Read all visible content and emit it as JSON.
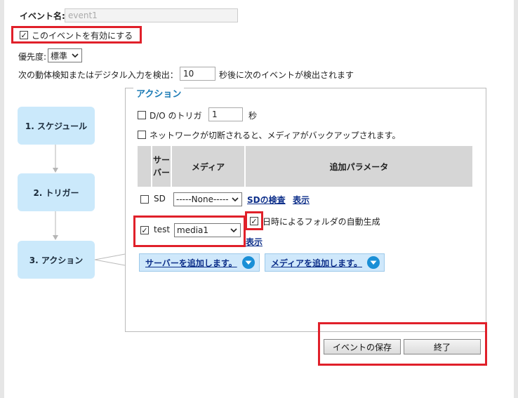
{
  "event_name": {
    "label": "イベント名:",
    "value": "event1"
  },
  "enable_event": {
    "label": "このイベントを有効にする",
    "checked": true,
    "mark": "✓"
  },
  "priority": {
    "label": "優先度:",
    "value": "標準"
  },
  "detection": {
    "prefix": "次の動体検知またはデジタル入力を検出：",
    "value": "10",
    "suffix": "秒後に次のイベントが検出されます"
  },
  "steps": [
    {
      "label": "1. スケジュール"
    },
    {
      "label": "2. トリガー"
    },
    {
      "label": "3. アクション"
    }
  ],
  "action": {
    "legend": "アクション",
    "do_trigger": {
      "label": "D/O のトリガ",
      "value": "1",
      "unit": "秒"
    },
    "network_backup": {
      "label": "ネットワークが切断されると、メディアがバックアップされます。"
    },
    "table": {
      "headers": {
        "server_line1": "サー",
        "server_line2": "バー",
        "media": "メディア",
        "params": "追加パラメータ"
      },
      "rows": [
        {
          "server": "SD",
          "media": "-----None-----",
          "link1": "SDの検査",
          "link2": "表示",
          "checked": false
        },
        {
          "server": "test",
          "media": "media1",
          "param_check_label": "日時によるフォルダの自動生成",
          "link2": "表示",
          "checked": true,
          "mark": "✓"
        }
      ]
    },
    "add_server": "サーバーを追加します。",
    "add_media": "メディアを追加します。"
  },
  "buttons": {
    "save": "イベントの保存",
    "close": "終了"
  },
  "colors": {
    "highlight": "#e0202a",
    "step_bg": "#cbe9fb",
    "link": "#0d2f8a",
    "legend": "#1c7bb5"
  }
}
